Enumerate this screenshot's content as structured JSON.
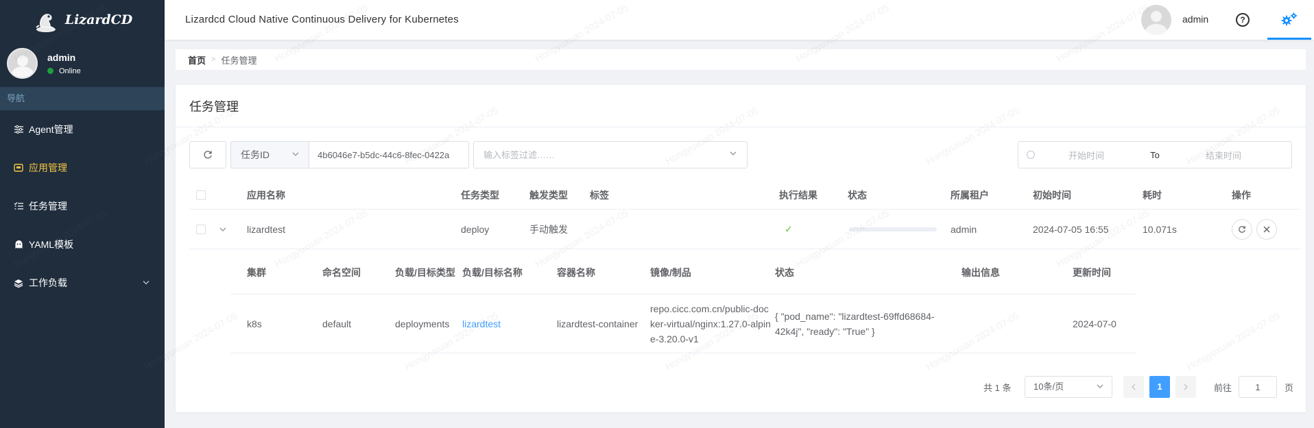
{
  "brand": {
    "name": "LizardCD"
  },
  "sidebar": {
    "user": {
      "name": "admin",
      "status": "Online"
    },
    "nav_header": "导航",
    "items": [
      {
        "label": "Agent管理",
        "icon": "sliders-icon"
      },
      {
        "label": "应用管理",
        "icon": "app-box-icon",
        "active": true
      },
      {
        "label": "任务管理",
        "icon": "task-list-icon"
      },
      {
        "label": "YAML模板",
        "icon": "ghost-icon"
      },
      {
        "label": "工作负载",
        "icon": "layers-icon",
        "expandable": true
      }
    ]
  },
  "header": {
    "title": "Lizardcd Cloud Native Continuous Delivery for Kubernetes",
    "user": "admin",
    "help_icon": "question-circle-icon",
    "settings_icon": "gears-icon"
  },
  "breadcrumb": {
    "home": "首页",
    "current": "任务管理"
  },
  "page": {
    "title": "任务管理"
  },
  "filters": {
    "type_select": "任务ID",
    "id_value": "4b6046e7-b5dc-44c6-8fec-0422a",
    "tag_placeholder": "输入标签过滤……",
    "date_start_placeholder": "开始时间",
    "date_to": "To",
    "date_end_placeholder": "结束时间"
  },
  "table": {
    "columns": [
      "应用名称",
      "任务类型",
      "触发类型",
      "标签",
      "执行结果",
      "状态",
      "所属租户",
      "初始时间",
      "耗时",
      "操作"
    ],
    "rows": [
      {
        "app_name": "lizardtest",
        "task_type": "deploy",
        "trigger_type": "手动触发",
        "tags": "",
        "result": "✓",
        "progress": 1.0,
        "tenant": "admin",
        "start_time": "2024-07-05 16:55",
        "duration": "10.071s"
      }
    ]
  },
  "sub_table": {
    "columns": [
      "集群",
      "命名空间",
      "负载/目标类型",
      "负载/目标名称",
      "容器名称",
      "镜像/制品",
      "状态",
      "输出信息",
      "更新时间"
    ],
    "rows": [
      {
        "cluster": "k8s",
        "namespace": "default",
        "workload_type": "deployments",
        "workload_name": "lizardtest",
        "container": "lizardtest-container",
        "image": "repo.cicc.com.cn/public-docker-virtual/nginx:1.27.0-alpine-3.20.0-v1",
        "status": "{ \"pod_name\": \"lizardtest-69ffd68684-42k4j\", \"ready\": \"True\" }",
        "output": "",
        "updated": "2024-07-0"
      }
    ]
  },
  "pagination": {
    "total": "共 1 条",
    "page_size": "10条/页",
    "current_page": "1",
    "goto_label": "前往",
    "goto_value": "1",
    "page_suffix": "页"
  },
  "watermark": "Hongyuxuan  2024-07-05",
  "colors": {
    "sidebar_bg": "#1f2d3d",
    "active_menu": "#f5c542",
    "primary": "#409eff",
    "success": "#67c23a"
  }
}
